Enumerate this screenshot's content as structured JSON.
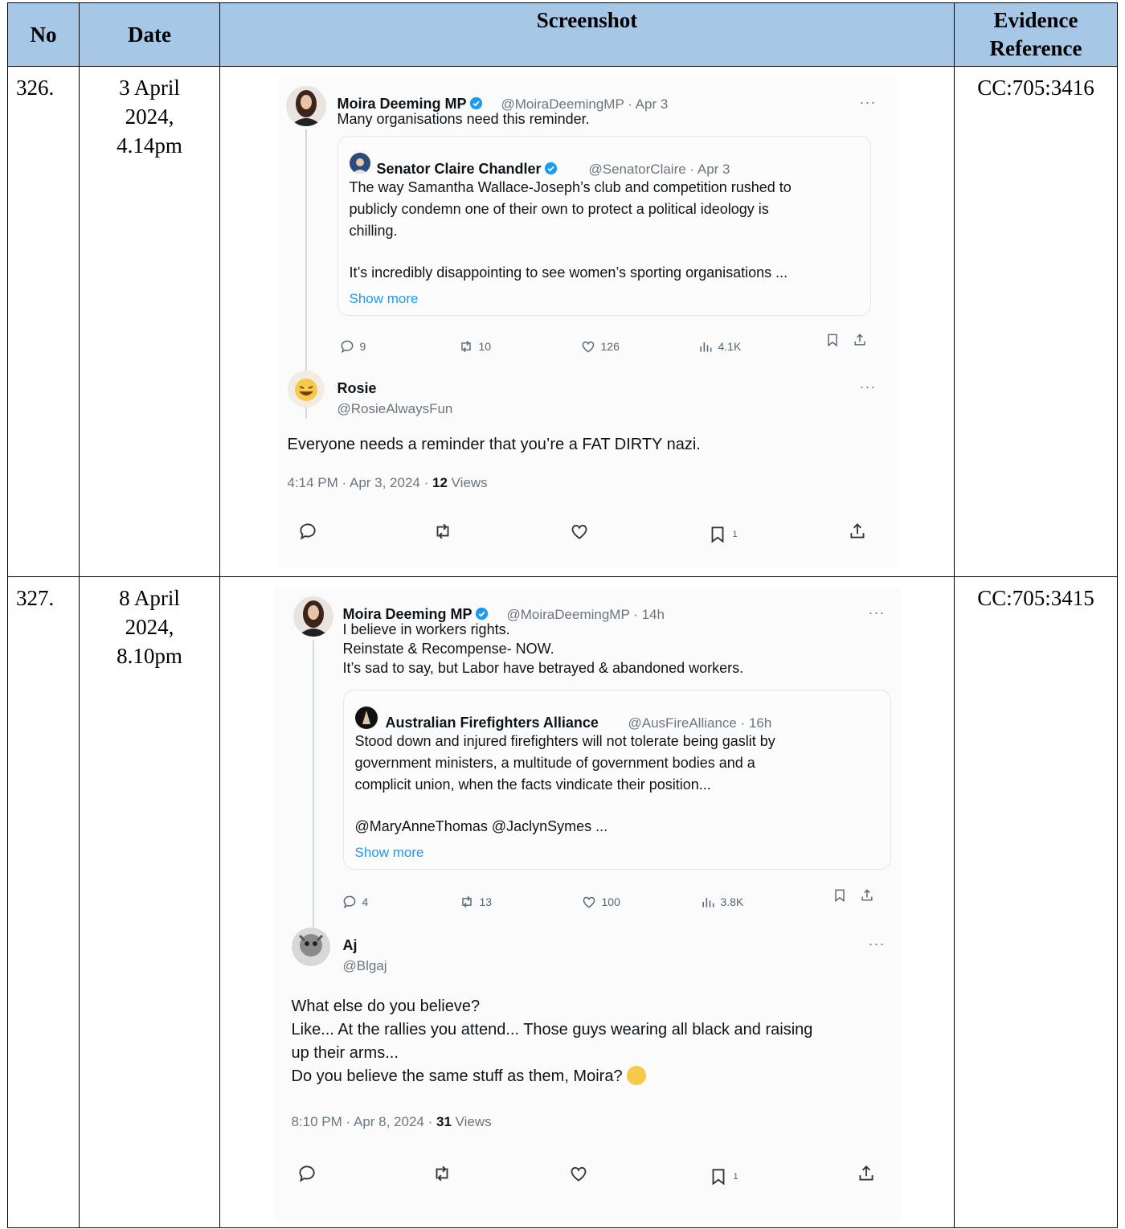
{
  "headers": {
    "no": "No",
    "date": "Date",
    "screenshot": "Screenshot",
    "evidence_line1": "Evidence",
    "evidence_line2": "Reference"
  },
  "rows": [
    {
      "no": "326.",
      "date_line1": "3 April",
      "date_line2": "2024,",
      "date_line3": "4.14pm",
      "evidence": "CC:705:3416",
      "tweet": {
        "author_name": "Moira Deeming MP",
        "author_handle_time": "@MoiraDeemingMP · Apr 3",
        "text": "Many organisations need this reminder.",
        "quote_name": "Senator Claire Chandler",
        "quote_handle_time": "@SenatorClaire · Apr 3",
        "quote_line1": "The way Samantha Wallace-Joseph’s club and competition rushed to",
        "quote_line2": "publicly condemn one of their own to protect a political ideology is",
        "quote_line3": "chilling.",
        "quote_line4": "It’s incredibly disappointing to see women’s sporting organisations ...",
        "show_more": "Show more",
        "replies": "9",
        "reposts": "10",
        "likes": "126",
        "views": "4.1K",
        "reply_name": "Rosie",
        "reply_handle": "@RosieAlwaysFun",
        "reply_line1": "Everyone needs a reminder that you’re a FAT DIRTY nazi.",
        "meta_time": "4:14 PM · Apr 3, 2024 · ",
        "meta_views_count": "12",
        "meta_views_label": " Views",
        "bookmarks": "1"
      }
    },
    {
      "no": "327.",
      "date_line1": "8 April",
      "date_line2": "2024,",
      "date_line3": "8.10pm",
      "evidence": "CC:705:3415",
      "tweet": {
        "author_name": "Moira Deeming MP",
        "author_handle_time": "@MoiraDeemingMP · 14h",
        "text_line1": "I believe in workers rights.",
        "text_line2": "Reinstate & Recompense- NOW.",
        "text_line3": "It’s sad to say, but Labor have betrayed & abandoned workers.",
        "quote_name": "Australian Firefighters Alliance",
        "quote_handle_time": "@AusFireAlliance · 16h",
        "quote_line1": "Stood down and injured firefighters will not tolerate being gaslit by",
        "quote_line2": "government ministers, a multitude of government bodies and a",
        "quote_line3": "complicit union, when the facts vindicate their position...",
        "quote_line4": "@MaryAnneThomas @JaclynSymes ...",
        "show_more": "Show more",
        "replies": "4",
        "reposts": "13",
        "likes": "100",
        "views": "3.8K",
        "reply_name": "Aj",
        "reply_handle": "@Blgaj",
        "reply_line1": "What else do you believe?",
        "reply_line2": "Like... At the rallies you attend... Those guys wearing all black and raising",
        "reply_line3": "up their arms...",
        "reply_line4": "Do you believe the same stuff as them, Moira?",
        "meta_time": "8:10 PM · Apr 8, 2024 · ",
        "meta_views_count": "31",
        "meta_views_label": " Views",
        "bookmarks": "1"
      }
    }
  ],
  "colors": {
    "header_bg": "#a7c7e7",
    "link_blue": "#1d9bf0",
    "verified_blue": "#1d9bf0"
  },
  "icons": [
    "reply-icon",
    "repost-icon",
    "like-icon",
    "views-icon",
    "bookmark-icon",
    "share-icon",
    "more-icon",
    "verified-badge-icon"
  ]
}
